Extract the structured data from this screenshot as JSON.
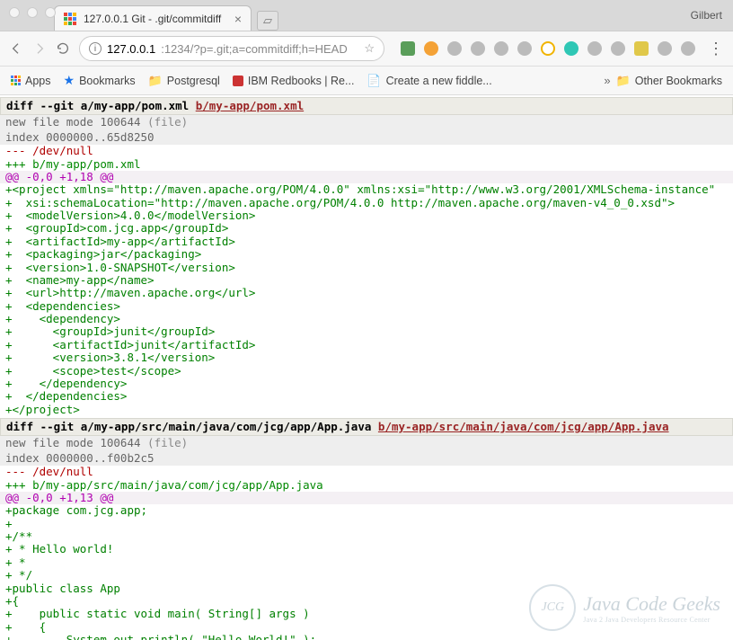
{
  "chrome": {
    "profile_name": "Gilbert",
    "tab": {
      "title": "127.0.0.1 Git - .git/commitdiff"
    },
    "url": {
      "host": "127.0.0.1",
      "port_path": ":1234/?p=.git;a=commitdiff;h=HEAD"
    },
    "bookmarks": {
      "apps": "Apps",
      "bookmarks": "Bookmarks",
      "postgresql": "Postgresql",
      "ibm": "IBM Redbooks | Re...",
      "fiddle": "Create a new fiddle...",
      "other": "Other Bookmarks"
    }
  },
  "diff1": {
    "header_prefix": "diff --git a/my-app/pom.xml ",
    "header_link": "b/my-app/pom.xml",
    "mode": "new file mode 100644 ",
    "mode_paren": "(file)",
    "index": "index 0000000..65d8250",
    "minus": "--- /dev/null",
    "plus": "+++ b/my-app/pom.xml",
    "hunk": "@@ -0,0 +1,18 @@",
    "lines": [
      "+<project xmlns=\"http://maven.apache.org/POM/4.0.0\" xmlns:xsi=\"http://www.w3.org/2001/XMLSchema-instance\"",
      "+  xsi:schemaLocation=\"http://maven.apache.org/POM/4.0.0 http://maven.apache.org/maven-v4_0_0.xsd\">",
      "+  <modelVersion>4.0.0</modelVersion>",
      "+  <groupId>com.jcg.app</groupId>",
      "+  <artifactId>my-app</artifactId>",
      "+  <packaging>jar</packaging>",
      "+  <version>1.0-SNAPSHOT</version>",
      "+  <name>my-app</name>",
      "+  <url>http://maven.apache.org</url>",
      "+  <dependencies>",
      "+    <dependency>",
      "+      <groupId>junit</groupId>",
      "+      <artifactId>junit</artifactId>",
      "+      <version>3.8.1</version>",
      "+      <scope>test</scope>",
      "+    </dependency>",
      "+  </dependencies>",
      "+</project>"
    ]
  },
  "diff2": {
    "header_prefix": "diff --git a/my-app/src/main/java/com/jcg/app/App.java ",
    "header_link": "b/my-app/src/main/java/com/jcg/app/App.java",
    "mode": "new file mode 100644 ",
    "mode_paren": "(file)",
    "index": "index 0000000..f00b2c5",
    "minus": "--- /dev/null",
    "plus": "+++ b/my-app/src/main/java/com/jcg/app/App.java",
    "hunk": "@@ -0,0 +1,13 @@",
    "lines": [
      "+package com.jcg.app;",
      "+",
      "+/**",
      "+ * Hello world!",
      "+ *",
      "+ */",
      "+public class App ",
      "+{",
      "+    public static void main( String[] args )",
      "+    {",
      "+        System.out.println( \"Hello World!\" );"
    ]
  },
  "watermark": {
    "badge": "JCG",
    "main": "Java Code Geeks",
    "sub": "Java 2 Java Developers Resource Center"
  }
}
